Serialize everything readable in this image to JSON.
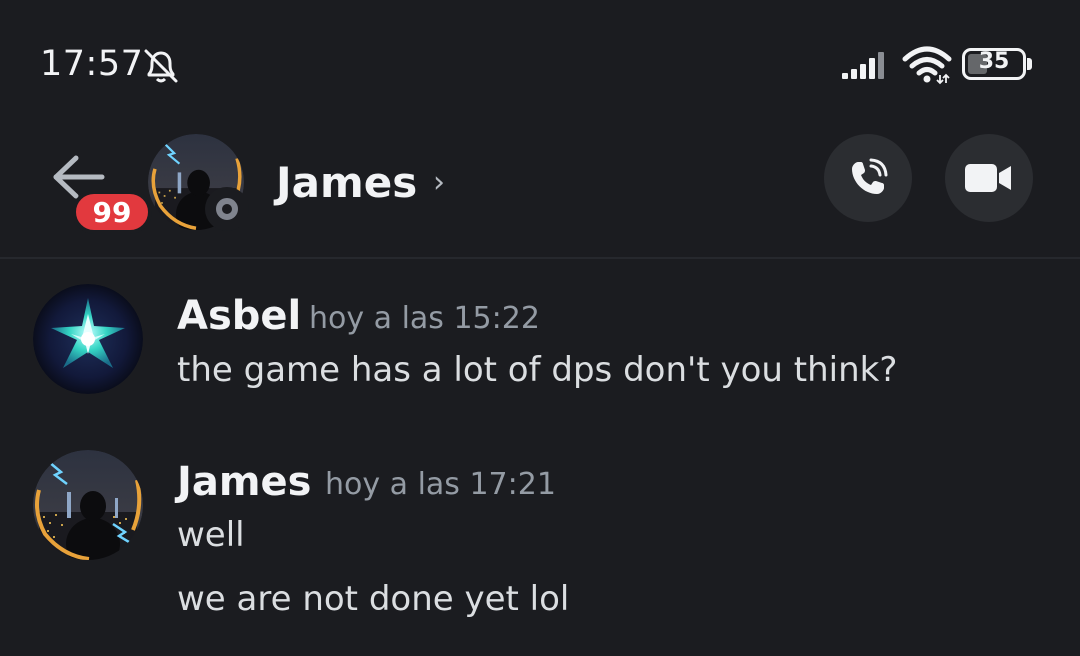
{
  "status_bar": {
    "time": "17:57",
    "battery": "35",
    "icons": [
      "bell-off-icon",
      "signal-icon",
      "wifi-icon",
      "battery-icon"
    ]
  },
  "header": {
    "back_icon": "arrow-left-icon",
    "unread_badge": "99",
    "contact_name": "James",
    "chevron": "›",
    "call_icon": "phone-call-icon",
    "video_icon": "video-camera-icon",
    "presence": "offline"
  },
  "messages": [
    {
      "author": "Asbel",
      "timestamp": "hoy a las 15:22",
      "lines": [
        "the game has a lot of dps don't you think?"
      ]
    },
    {
      "author": "James",
      "timestamp": "hoy a las 17:21",
      "lines": [
        "well",
        "we are not done yet lol"
      ]
    }
  ],
  "colors": {
    "background": "#1b1c20",
    "badge": "#e2393e",
    "button_bg": "#2b2d31",
    "muted_text": "#949ba4",
    "offline": "#80848e"
  }
}
